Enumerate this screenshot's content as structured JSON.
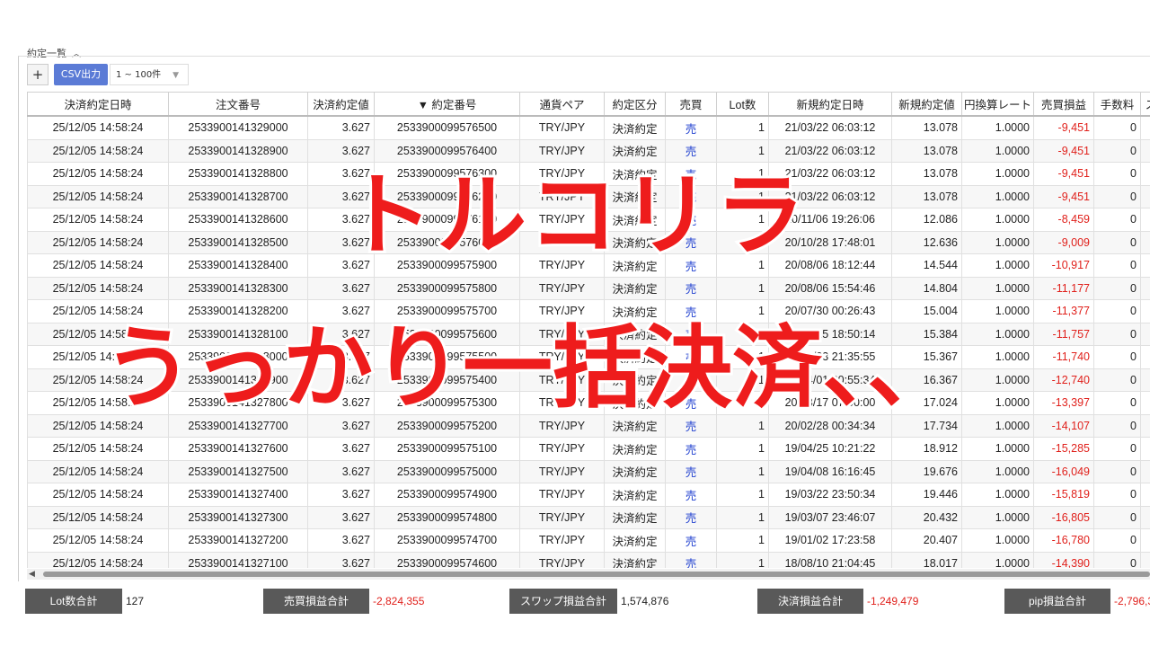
{
  "panel": {
    "title": "約定一覧"
  },
  "toolbar": {
    "add_label": "+",
    "csv_label": "CSV出力",
    "range_value": "1 ~ 100件"
  },
  "table": {
    "columns": [
      "決済約定日時",
      "注文番号",
      "決済約定値",
      "▼ 約定番号",
      "通貨ペア",
      "約定区分",
      "売買",
      "Lot数",
      "新規約定日時",
      "新規約定値",
      "円換算レート",
      "売買損益",
      "手数料",
      "ス"
    ],
    "rows": [
      [
        "25/12/05 14:58:24",
        "2533900141329000",
        "3.627",
        "2533900099576500",
        "TRY/JPY",
        "決済約定",
        "売",
        "1",
        "21/03/22 06:03:12",
        "13.078",
        "1.0000",
        "-9,451",
        "0"
      ],
      [
        "25/12/05 14:58:24",
        "2533900141328900",
        "3.627",
        "2533900099576400",
        "TRY/JPY",
        "決済約定",
        "売",
        "1",
        "21/03/22 06:03:12",
        "13.078",
        "1.0000",
        "-9,451",
        "0"
      ],
      [
        "25/12/05 14:58:24",
        "2533900141328800",
        "3.627",
        "2533900099576300",
        "TRY/JPY",
        "決済約定",
        "売",
        "1",
        "21/03/22 06:03:12",
        "13.078",
        "1.0000",
        "-9,451",
        "0"
      ],
      [
        "25/12/05 14:58:24",
        "2533900141328700",
        "3.627",
        "2533900099576200",
        "TRY/JPY",
        "決済約定",
        "売",
        "1",
        "21/03/22 06:03:12",
        "13.078",
        "1.0000",
        "-9,451",
        "0"
      ],
      [
        "25/12/05 14:58:24",
        "2533900141328600",
        "3.627",
        "2533900099576100",
        "TRY/JPY",
        "決済約定",
        "売",
        "1",
        "20/11/06 19:26:06",
        "12.086",
        "1.0000",
        "-8,459",
        "0"
      ],
      [
        "25/12/05 14:58:24",
        "2533900141328500",
        "3.627",
        "2533900099576000",
        "TRY/JPY",
        "決済約定",
        "売",
        "1",
        "20/10/28 17:48:01",
        "12.636",
        "1.0000",
        "-9,009",
        "0"
      ],
      [
        "25/12/05 14:58:24",
        "2533900141328400",
        "3.627",
        "2533900099575900",
        "TRY/JPY",
        "決済約定",
        "売",
        "1",
        "20/08/06 18:12:44",
        "14.544",
        "1.0000",
        "-10,917",
        "0"
      ],
      [
        "25/12/05 14:58:24",
        "2533900141328300",
        "3.627",
        "2533900099575800",
        "TRY/JPY",
        "決済約定",
        "売",
        "1",
        "20/08/06 15:54:46",
        "14.804",
        "1.0000",
        "-11,177",
        "0"
      ],
      [
        "25/12/05 14:58:24",
        "2533900141328200",
        "3.627",
        "2533900099575700",
        "TRY/JPY",
        "決済約定",
        "売",
        "1",
        "20/07/30 00:26:43",
        "15.004",
        "1.0000",
        "-11,377",
        "0"
      ],
      [
        "25/12/05 14:58:24",
        "2533900141328100",
        "3.627",
        "2533900099575600",
        "TRY/JPY",
        "決済約定",
        "売",
        "1",
        "20/07/15 18:50:14",
        "15.384",
        "1.0000",
        "-11,757",
        "0"
      ],
      [
        "25/12/05 14:58:24",
        "2533900141328000",
        "3.627",
        "2533900099575500",
        "TRY/JPY",
        "決済約定",
        "売",
        "1",
        "20/06/03 21:35:55",
        "15.367",
        "1.0000",
        "-11,740",
        "0"
      ],
      [
        "25/12/05 14:58:24",
        "2533900141327900",
        "3.627",
        "2533900099575400",
        "TRY/JPY",
        "決済約定",
        "売",
        "1",
        "20/04/01 00:55:34",
        "16.367",
        "1.0000",
        "-12,740",
        "0"
      ],
      [
        "25/12/05 14:58:24",
        "2533900141327800",
        "3.627",
        "2533900099575300",
        "TRY/JPY",
        "決済約定",
        "売",
        "1",
        "20/03/17 07:00:00",
        "17.024",
        "1.0000",
        "-13,397",
        "0"
      ],
      [
        "25/12/05 14:58:24",
        "2533900141327700",
        "3.627",
        "2533900099575200",
        "TRY/JPY",
        "決済約定",
        "売",
        "1",
        "20/02/28 00:34:34",
        "17.734",
        "1.0000",
        "-14,107",
        "0"
      ],
      [
        "25/12/05 14:58:24",
        "2533900141327600",
        "3.627",
        "2533900099575100",
        "TRY/JPY",
        "決済約定",
        "売",
        "1",
        "19/04/25 10:21:22",
        "18.912",
        "1.0000",
        "-15,285",
        "0"
      ],
      [
        "25/12/05 14:58:24",
        "2533900141327500",
        "3.627",
        "2533900099575000",
        "TRY/JPY",
        "決済約定",
        "売",
        "1",
        "19/04/08 16:16:45",
        "19.676",
        "1.0000",
        "-16,049",
        "0"
      ],
      [
        "25/12/05 14:58:24",
        "2533900141327400",
        "3.627",
        "2533900099574900",
        "TRY/JPY",
        "決済約定",
        "売",
        "1",
        "19/03/22 23:50:34",
        "19.446",
        "1.0000",
        "-15,819",
        "0"
      ],
      [
        "25/12/05 14:58:24",
        "2533900141327300",
        "3.627",
        "2533900099574800",
        "TRY/JPY",
        "決済約定",
        "売",
        "1",
        "19/03/07 23:46:07",
        "20.432",
        "1.0000",
        "-16,805",
        "0"
      ],
      [
        "25/12/05 14:58:24",
        "2533900141327200",
        "3.627",
        "2533900099574700",
        "TRY/JPY",
        "決済約定",
        "売",
        "1",
        "19/01/02 17:23:58",
        "20.407",
        "1.0000",
        "-16,780",
        "0"
      ],
      [
        "25/12/05 14:58:24",
        "2533900141327100",
        "3.627",
        "2533900099574600",
        "TRY/JPY",
        "決済約定",
        "売",
        "1",
        "18/08/10 21:04:45",
        "18.017",
        "1.0000",
        "-14,390",
        "0"
      ]
    ]
  },
  "footer": {
    "lot_label": "Lot数合計",
    "lot_value": "127",
    "trade_pl_label": "売買損益合計",
    "trade_pl_value": "-2,824,355",
    "swap_label": "スワップ損益合計",
    "swap_value": "1,574,876",
    "settle_label": "決済損益合計",
    "settle_value": "-1,249,479",
    "pip_label": "pip損益合計",
    "pip_value": "-2,796,3"
  },
  "overlay": {
    "line1": "トルコリラ",
    "line2": "うっかり一括決済、、"
  },
  "colors": {
    "accent": "#5b7bd6",
    "negative": "#e0201b",
    "sell": "#1f3fcf",
    "overlay_text": "#ee1c1c"
  }
}
